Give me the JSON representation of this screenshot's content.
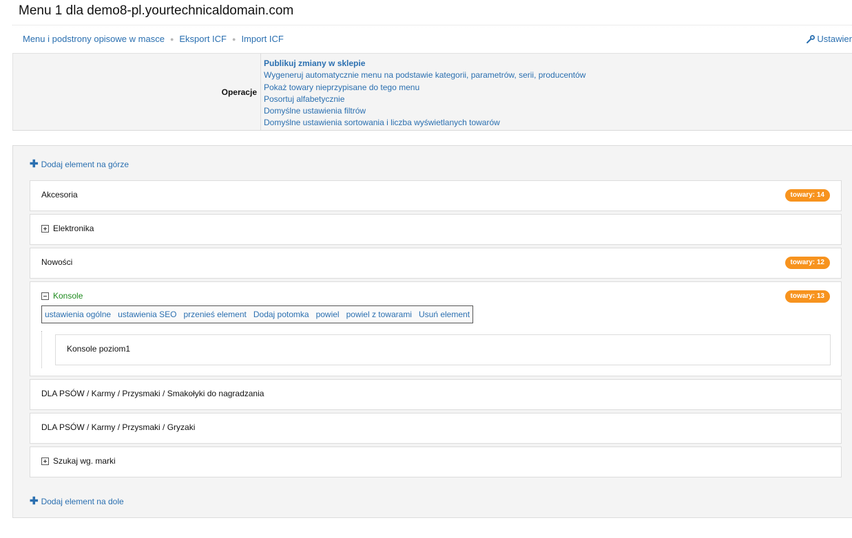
{
  "page": {
    "title": "Menu 1 dla demo8-pl.yourtechnicaldomain.com"
  },
  "nav": {
    "links": [
      "Menu i podstrony opisowe w masce",
      "Eksport ICF",
      "Import ICF"
    ],
    "settings_label": "Ustawier"
  },
  "operations": {
    "label": "Operacje",
    "links": [
      "Publikuj zmiany w sklepie",
      "Wygeneruj automatycznie menu na podstawie kategorii, parametrów, serii, producentów",
      "Pokaż towary nieprzypisane do tego menu",
      "Posortuj alfabetycznie",
      "Domyślne ustawienia filtrów",
      "Domyślne ustawienia sortowania i liczba wyświetlanych towarów"
    ]
  },
  "menu": {
    "add_top": "Dodaj element na górze",
    "add_bottom": "Dodaj element na dole",
    "items": [
      {
        "label": "Akcesoria",
        "badge": "towary: 14"
      },
      {
        "label": "Elektronika",
        "toggle": "plus"
      },
      {
        "label": "Nowości",
        "badge": "towary: 12"
      },
      {
        "label": "Konsole",
        "toggle": "minus",
        "badge": "towary: 13",
        "actions": [
          "ustawienia ogólne",
          "ustawienia SEO",
          "przenieś element",
          "Dodaj potomka",
          "powiel",
          "powiel z towarami",
          "Usuń element"
        ],
        "children": [
          {
            "label": "Konsole poziom1"
          }
        ]
      },
      {
        "label": "DLA PSÓW / Karmy / Przysmaki / Smakołyki do nagradzania"
      },
      {
        "label": "DLA PSÓW / Karmy / Przysmaki / Gryzaki"
      },
      {
        "label": "Szukaj wg. marki",
        "toggle": "plus"
      }
    ]
  },
  "colors": {
    "link": "#2a6fb0",
    "badge": "#f7931e",
    "active": "#1d8a1d"
  }
}
